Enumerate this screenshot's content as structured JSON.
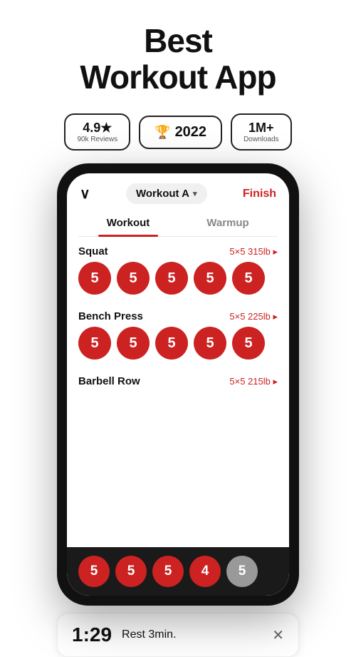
{
  "header": {
    "title_line1": "Best",
    "title_line2": "Workout App"
  },
  "badges": [
    {
      "id": "rating",
      "main": "4.9★",
      "sub": "90k Reviews"
    },
    {
      "id": "award",
      "main": "🏆 2022",
      "sub": null
    },
    {
      "id": "downloads",
      "main": "1M+",
      "sub": "Downloads"
    }
  ],
  "app": {
    "workout_name": "Workout A",
    "finish_label": "Finish",
    "tabs": [
      {
        "label": "Workout",
        "active": true
      },
      {
        "label": "Warmup",
        "active": false
      }
    ],
    "exercises": [
      {
        "name": "Squat",
        "info": "5×5 315lb ▸",
        "sets": [
          5,
          5,
          5,
          5,
          5
        ],
        "set_colors": [
          "red",
          "red",
          "red",
          "red",
          "red"
        ]
      },
      {
        "name": "Bench Press",
        "info": "5×5 225lb ▸",
        "sets": [
          5,
          5,
          5,
          5,
          5
        ],
        "set_colors": [
          "red",
          "red",
          "red",
          "red",
          "red"
        ]
      },
      {
        "name": "Barbell Row",
        "info": "5×5 215lb ▸",
        "sets": [
          5,
          5,
          5,
          4,
          5
        ],
        "set_colors": [
          "red",
          "red",
          "red",
          "red",
          "grey"
        ]
      }
    ],
    "bottom_sets": [
      5,
      5,
      5,
      4,
      5
    ],
    "bottom_set_colors": [
      "red",
      "red",
      "red",
      "red",
      "grey"
    ]
  },
  "rest_timer": {
    "time": "1:29",
    "label": "Rest 3min."
  },
  "icons": {
    "chevron": "∨",
    "dropdown": "▾",
    "trophy": "🏆",
    "close": "✕"
  }
}
